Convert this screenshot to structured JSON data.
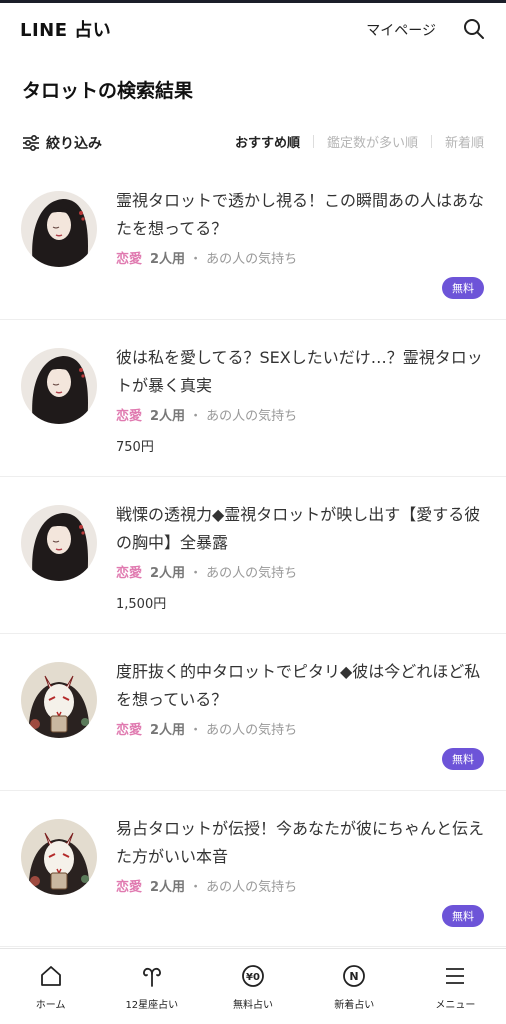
{
  "header": {
    "logo": "LINE 占い",
    "mypage_label": "マイページ"
  },
  "page_title": "タロットの検索結果",
  "filter": {
    "label": "絞り込み"
  },
  "sort": {
    "options": [
      "おすすめ順",
      "鑑定数が多い順",
      "新着順"
    ],
    "active": "おすすめ順"
  },
  "items": [
    {
      "title": "霊視タロットで透かし視る！この瞬間あの人はあなたを想ってる？",
      "category": "恋愛",
      "users": "2人用",
      "separator": "・",
      "tag": "あの人の気持ち",
      "badge": "無料",
      "price": ""
    },
    {
      "title": "彼は私を愛してる？SEXしたいだけ…？霊視タロットが暴く真実",
      "category": "恋愛",
      "users": "2人用",
      "separator": "・",
      "tag": "あの人の気持ち",
      "badge": "",
      "price": "750円"
    },
    {
      "title": "戦慄の透視力◆霊視タロットが映し出す【愛する彼の胸中】全暴露",
      "category": "恋愛",
      "users": "2人用",
      "separator": "・",
      "tag": "あの人の気持ち",
      "badge": "",
      "price": "1,500円"
    },
    {
      "title": "度肝抜く的中タロットでピタリ◆彼は今どれほど私を想っている？",
      "category": "恋愛",
      "users": "2人用",
      "separator": "・",
      "tag": "あの人の気持ち",
      "badge": "無料",
      "price": ""
    },
    {
      "title": "易占タロットが伝授！今あなたが彼にちゃんと伝えた方がいい本音",
      "category": "恋愛",
      "users": "2人用",
      "separator": "・",
      "tag": "あの人の気持ち",
      "badge": "無料",
      "price": ""
    }
  ],
  "bottom_nav": [
    {
      "label": "ホーム",
      "icon": "home-icon"
    },
    {
      "label": "12星座占い",
      "icon": "aries-icon"
    },
    {
      "label": "無料占い",
      "icon": "yen-zero-icon"
    },
    {
      "label": "新着占い",
      "icon": "new-icon"
    },
    {
      "label": "メニュー",
      "icon": "menu-icon"
    }
  ],
  "colors": {
    "accent_pink": "#e07ab0",
    "badge_purple": "#6d54d8",
    "topbar": "#1b1e29"
  }
}
